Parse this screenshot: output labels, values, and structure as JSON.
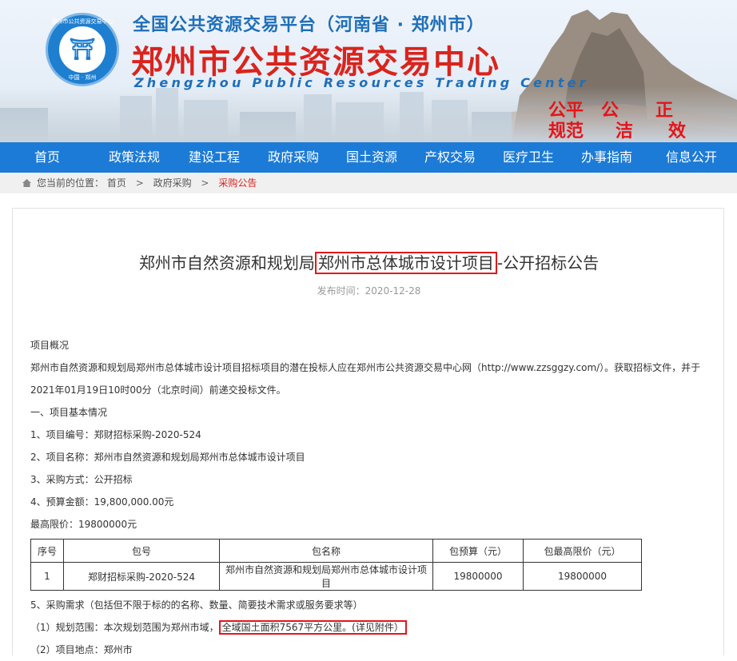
{
  "header": {
    "logo_ring_top": "郑州市公共资源交易中心",
    "logo_ring_bottom": "中国 · 郑州",
    "subtitle": "全国公共资源交易平台（河南省 · 郑州市）",
    "title": "郑州市公共资源交易中心",
    "title_en": "Zhengzhou Public Resources Trading Center",
    "slogan": [
      "公平",
      "公",
      "正",
      "规范",
      "洁",
      "效"
    ]
  },
  "nav": [
    "首页",
    "政策法规",
    "建设工程",
    "政府采购",
    "国土资源",
    "产权交易",
    "医疗卫生",
    "办事指南",
    "信息公开"
  ],
  "breadcrumb": {
    "prefix": "您当前的位置：",
    "items": [
      "首页",
      "政府采购"
    ],
    "current": "采购公告",
    "separator": ">"
  },
  "article": {
    "title_pre": "郑州市自然资源和规划局",
    "title_highlight": "郑州市总体城市设计项目",
    "title_post": "-公开招标公告",
    "date": "发布时间：2020-12-28",
    "overview_heading": "项目概况",
    "overview_text": "郑州市自然资源和规划局郑州市总体城市设计项目招标项目的潜在投标人应在郑州市公共资源交易中心网（http://www.zzsggzy.com/）。获取招标文件，并于2021年01月19日10时00分（北京时间）前递交投标文件。",
    "section1": "一、项目基本情况",
    "item1": "1、项目编号：郑财招标采购-2020-524",
    "item2": "2、项目名称：郑州市自然资源和规划局郑州市总体城市设计项目",
    "item3": "3、采购方式：公开招标",
    "item4": "4、预算金额：19,800,000.00元",
    "max_price": "最高限价：19800000元",
    "table": {
      "headers": [
        "序号",
        "包号",
        "包名称",
        "包预算（元）",
        "包最高限价（元）"
      ],
      "rows": [
        [
          "1",
          "郑财招标采购-2020-524",
          "郑州市自然资源和规划局郑州市总体城市设计项目",
          "19800000",
          "19800000"
        ]
      ]
    },
    "item5": "5、采购需求（包括但不限于标的的名称、数量、简要技术需求或服务要求等）",
    "req1_pre": "（1）规划范围：本次规划范围为郑州市域，",
    "req1_mark": "全域国土面积7567平方公里。(详见附件）",
    "req2": "（2）项目地点：郑州市"
  },
  "colors": {
    "nav_bg": "#1c7bd6",
    "title_red": "#d9241d",
    "highlight_border": "#e3151b",
    "sub_blue": "#1f6fb8"
  }
}
